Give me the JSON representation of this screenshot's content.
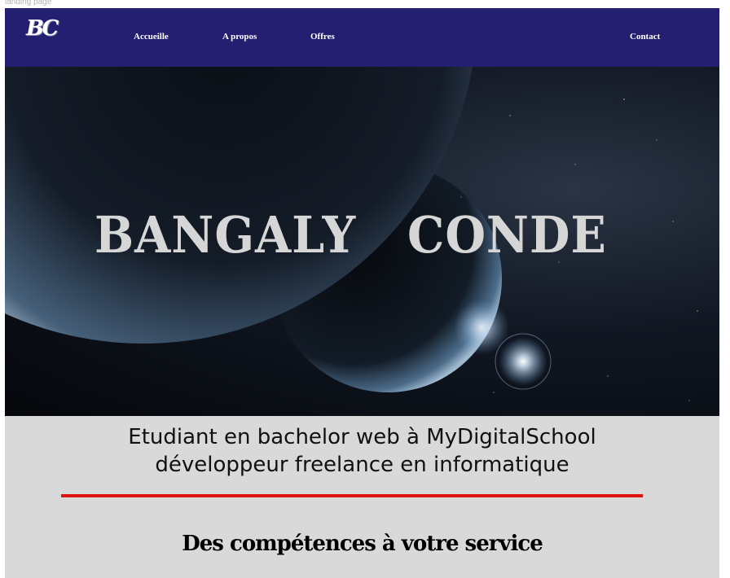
{
  "frame_label": "landing page",
  "nav": {
    "logo": "BC",
    "items": [
      "Accueille",
      "A propos",
      "Offres"
    ],
    "contact": "Contact"
  },
  "hero": {
    "first_name": "BANGALY",
    "last_name": "CONDE"
  },
  "intro": {
    "line1": "Etudiant en bachelor web à MyDigitalSchool",
    "line2": "développeur freelance en informatique"
  },
  "services": {
    "title": "Des compétences à votre service"
  },
  "colors": {
    "nav_bg": "#241f70",
    "divider": "#e11212",
    "page_bg": "#d9d9d9"
  }
}
